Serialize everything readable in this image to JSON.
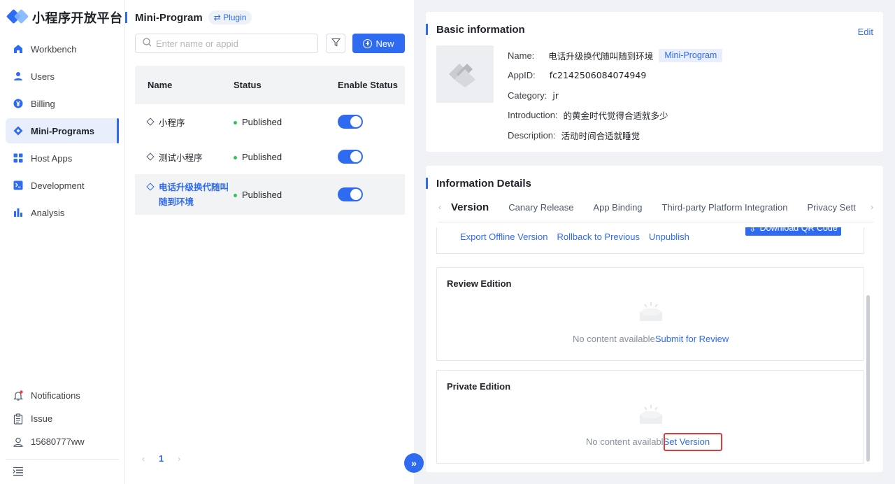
{
  "app": {
    "name": "小程序开放平台"
  },
  "sidebar": {
    "items": [
      {
        "label": "Workbench",
        "icon": "home-icon"
      },
      {
        "label": "Users",
        "icon": "user-icon"
      },
      {
        "label": "Billing",
        "icon": "yen-icon"
      },
      {
        "label": "Mini-Programs",
        "icon": "diamond-icon",
        "active": true
      },
      {
        "label": "Host Apps",
        "icon": "grid-icon"
      },
      {
        "label": "Development",
        "icon": "terminal-icon"
      },
      {
        "label": "Analysis",
        "icon": "bar-chart-icon"
      }
    ],
    "bottom": [
      {
        "label": "Notifications",
        "icon": "bell-icon"
      },
      {
        "label": "Issue",
        "icon": "clipboard-icon"
      },
      {
        "label": "15680777ww",
        "icon": "user-outline-icon"
      }
    ]
  },
  "list": {
    "title": "Mini-Program",
    "plugin_tag": "⇄ Plugin",
    "search_placeholder": "Enter name or appid",
    "new_label": "New",
    "headers": {
      "name": "Name",
      "status": "Status",
      "enable": "Enable Status"
    },
    "rows": [
      {
        "name": "小程序",
        "status": "Published",
        "enabled": true
      },
      {
        "name": "测试小程序",
        "status": "Published",
        "enabled": true
      },
      {
        "name": "电话升级换代随叫随到环境",
        "status": "Published",
        "enabled": true,
        "selected": true
      }
    ],
    "page": "1"
  },
  "basic": {
    "title": "Basic information",
    "edit": "Edit",
    "name_label": "Name:",
    "name": "电话升级换代随叫随到环境",
    "type_tag": "Mini-Program",
    "appid_label": "AppID:",
    "appid": "fc2142506084074949",
    "category_label": "Category:",
    "category": "jr",
    "intro_label": "Introduction:",
    "intro": "的黄金时代觉得合适就多少",
    "desc_label": "Description:",
    "desc": "活动时间合适就睡觉"
  },
  "details": {
    "title": "Information Details",
    "tabs": [
      "Version",
      "Canary Release",
      "App Binding",
      "Third-party Platform Integration",
      "Privacy Sett"
    ],
    "actions": [
      "Export Offline Version",
      "Rollback to Previous",
      "Unpublish"
    ],
    "download_label": "Download QR Code",
    "review": {
      "title": "Review Edition",
      "empty": "No content available",
      "link": "Submit for Review"
    },
    "private": {
      "title": "Private Edition",
      "empty": "No content availabl",
      "link": "Set Version"
    }
  },
  "colors": {
    "primary": "#2f6bf0",
    "highlight": "#e03b3b",
    "success": "#35c05a"
  }
}
